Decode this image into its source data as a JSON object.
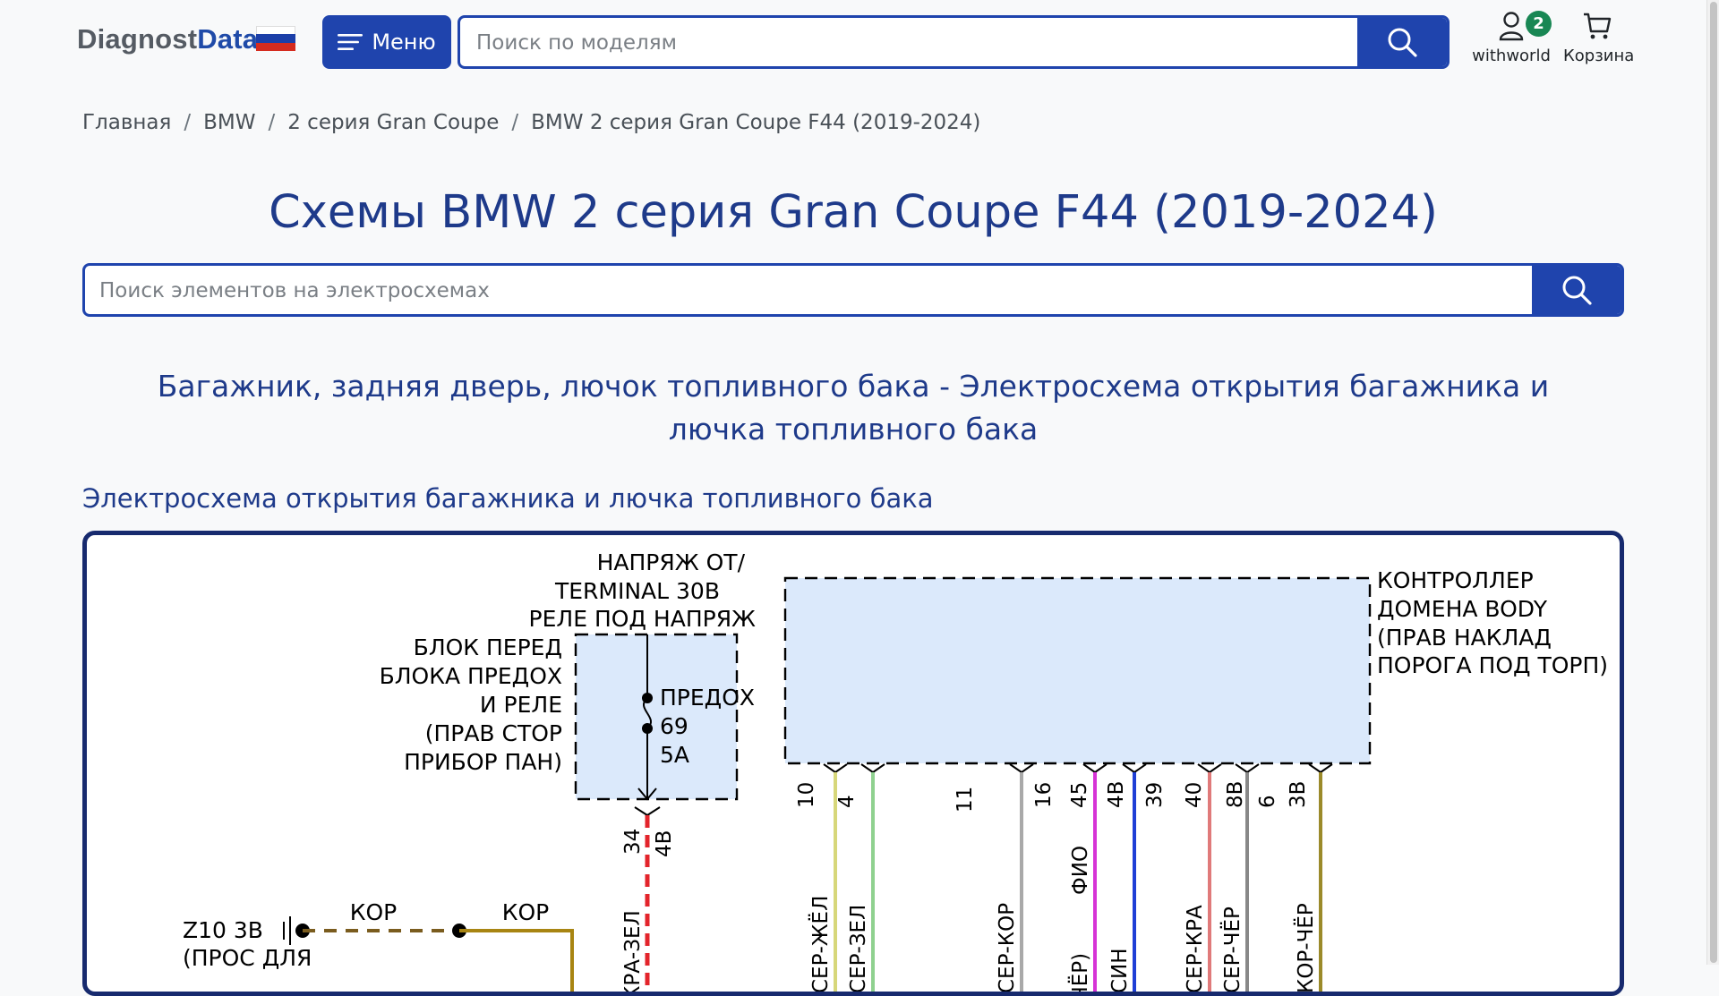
{
  "header": {
    "logo_part1": "Diagnost",
    "logo_part2": "Data",
    "menu_label": "Меню",
    "search_placeholder": "Поиск по моделям",
    "user_label": "withworld",
    "user_badge": "2",
    "cart_label": "Корзина"
  },
  "breadcrumb": [
    "Главная",
    "BMW",
    "2 серия Gran Coupe",
    "BMW 2 серия Gran Coupe F44 (2019-2024)"
  ],
  "page_title": "Схемы BMW 2 серия Gran Coupe F44 (2019-2024)",
  "element_search_placeholder": "Поиск элементов на электросхемах",
  "section_title": "Багажник, задняя дверь, лючок топливного бака - Электросхема открытия багажника и лючка топливного бака",
  "diagram_title": "Электросхема открытия багажника и лючка топливного бака",
  "diagram": {
    "power_label": [
      "НАПРЯЖ ОТ/",
      "TERMINAL 30B",
      "РЕЛЕ ПОД НАПРЯЖ"
    ],
    "fuse_block_label": [
      "БЛОК ПЕРЕД",
      "БЛОКА ПРЕДОХ",
      "И РЕЛЕ",
      "(ПРАВ СТОР",
      "ПРИБОР ПАН)"
    ],
    "fuse": [
      "ПРЕДОХ",
      "69",
      "5А"
    ],
    "controller_label": [
      "КОНТРОЛЛЕР",
      "ДОМЕНА BODY",
      "(ПРАВ НАКЛАД",
      "ПОРОГА ПОД ТОРП)"
    ],
    "fuse_pins": [
      "34",
      "4B"
    ],
    "fuse_wire": "КРА-ЗЕЛ",
    "ground_label": [
      "Z10 3B",
      "(ПРОС ДЛЯ"
    ],
    "ground_wires": [
      "КОР",
      "КОР"
    ],
    "controller_pins": [
      "10",
      "4",
      "11",
      "16",
      "45",
      "4B",
      "39",
      "40",
      "8B",
      "6",
      "3B"
    ],
    "wires": [
      "СЕР-ЖЁЛ",
      "СЕР-ЗЕЛ",
      "СЕР-КОР",
      "ФИО",
      "СИН",
      "СЕР-КРА",
      "СЕР-ЧЁР",
      "КОР-ЧЁР"
    ],
    "wire_fragment": "ЧЁР)"
  },
  "colors": {
    "brand": "#1f44ad",
    "title": "#1e3a8a",
    "badge": "#198754",
    "diagram_fill": "#dbe9fb"
  }
}
